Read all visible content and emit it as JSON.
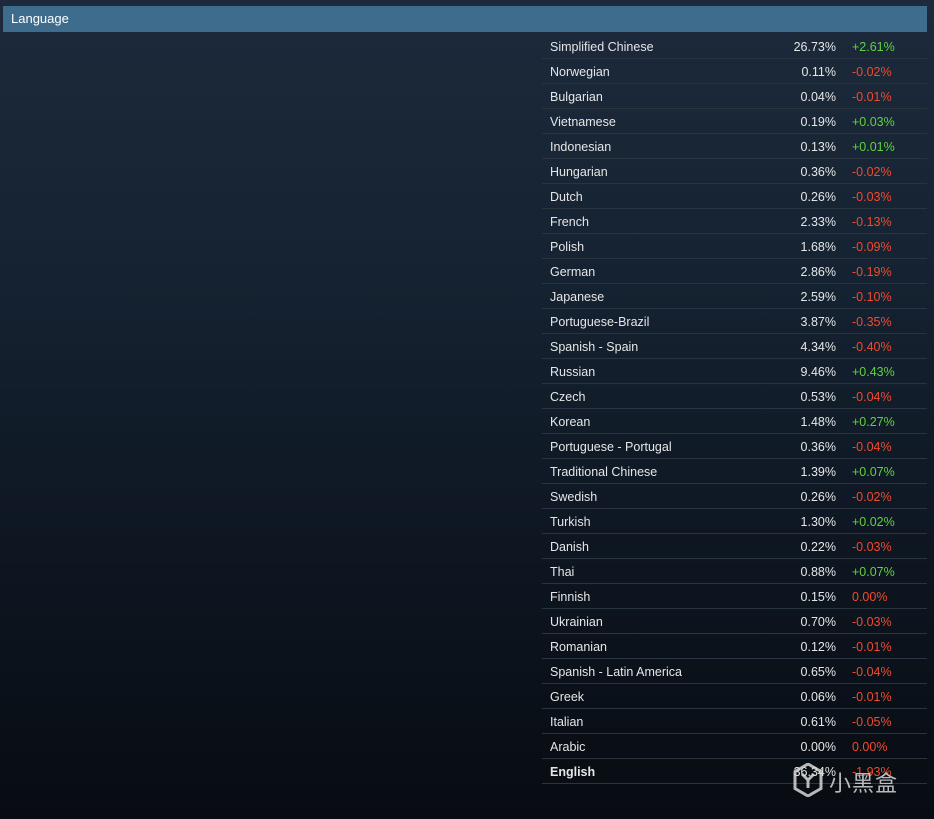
{
  "header": {
    "title": "Language"
  },
  "colors": {
    "header_bg": "#3d6c8d",
    "positive": "#5fd43c",
    "negative": "#f04b2e"
  },
  "languages": [
    {
      "name": "Simplified Chinese",
      "pct": "26.73%",
      "change": "+2.61%",
      "trend": "up"
    },
    {
      "name": "Norwegian",
      "pct": "0.11%",
      "change": "-0.02%",
      "trend": "down"
    },
    {
      "name": "Bulgarian",
      "pct": "0.04%",
      "change": "-0.01%",
      "trend": "down"
    },
    {
      "name": "Vietnamese",
      "pct": "0.19%",
      "change": "+0.03%",
      "trend": "up"
    },
    {
      "name": "Indonesian",
      "pct": "0.13%",
      "change": "+0.01%",
      "trend": "up"
    },
    {
      "name": "Hungarian",
      "pct": "0.36%",
      "change": "-0.02%",
      "trend": "down"
    },
    {
      "name": "Dutch",
      "pct": "0.26%",
      "change": "-0.03%",
      "trend": "down"
    },
    {
      "name": "French",
      "pct": "2.33%",
      "change": "-0.13%",
      "trend": "down"
    },
    {
      "name": "Polish",
      "pct": "1.68%",
      "change": "-0.09%",
      "trend": "down"
    },
    {
      "name": "German",
      "pct": "2.86%",
      "change": "-0.19%",
      "trend": "down"
    },
    {
      "name": "Japanese",
      "pct": "2.59%",
      "change": "-0.10%",
      "trend": "down"
    },
    {
      "name": "Portuguese-Brazil",
      "pct": "3.87%",
      "change": "-0.35%",
      "trend": "down"
    },
    {
      "name": "Spanish - Spain",
      "pct": "4.34%",
      "change": "-0.40%",
      "trend": "down"
    },
    {
      "name": "Russian",
      "pct": "9.46%",
      "change": "+0.43%",
      "trend": "up"
    },
    {
      "name": "Czech",
      "pct": "0.53%",
      "change": "-0.04%",
      "trend": "down"
    },
    {
      "name": "Korean",
      "pct": "1.48%",
      "change": "+0.27%",
      "trend": "up"
    },
    {
      "name": "Portuguese - Portugal",
      "pct": "0.36%",
      "change": "-0.04%",
      "trend": "down"
    },
    {
      "name": "Traditional Chinese",
      "pct": "1.39%",
      "change": "+0.07%",
      "trend": "up"
    },
    {
      "name": "Swedish",
      "pct": "0.26%",
      "change": "-0.02%",
      "trend": "down"
    },
    {
      "name": "Turkish",
      "pct": "1.30%",
      "change": "+0.02%",
      "trend": "up"
    },
    {
      "name": "Danish",
      "pct": "0.22%",
      "change": "-0.03%",
      "trend": "down"
    },
    {
      "name": "Thai",
      "pct": "0.88%",
      "change": "+0.07%",
      "trend": "up"
    },
    {
      "name": "Finnish",
      "pct": "0.15%",
      "change": "0.00%",
      "trend": "down"
    },
    {
      "name": "Ukrainian",
      "pct": "0.70%",
      "change": "-0.03%",
      "trend": "down"
    },
    {
      "name": "Romanian",
      "pct": "0.12%",
      "change": "-0.01%",
      "trend": "down"
    },
    {
      "name": "Spanish - Latin America",
      "pct": "0.65%",
      "change": "-0.04%",
      "trend": "down"
    },
    {
      "name": "Greek",
      "pct": "0.06%",
      "change": "-0.01%",
      "trend": "down"
    },
    {
      "name": "Italian",
      "pct": "0.61%",
      "change": "-0.05%",
      "trend": "down"
    },
    {
      "name": "Arabic",
      "pct": "0.00%",
      "change": "0.00%",
      "trend": "down"
    },
    {
      "name": "English",
      "pct": "36.34%",
      "change": "-1.93%",
      "trend": "down",
      "bold": true
    }
  ],
  "watermark": {
    "text": "小黑盒",
    "icon": "heybox-logo-icon"
  }
}
